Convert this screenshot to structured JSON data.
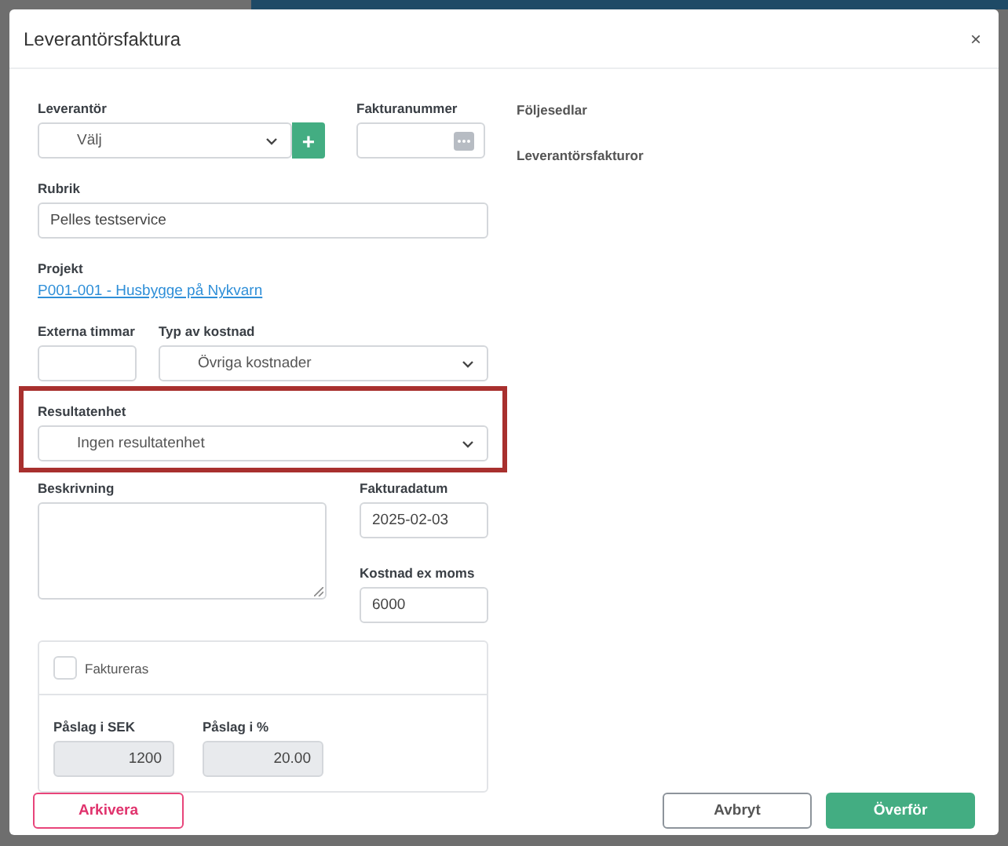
{
  "dialog": {
    "title": "Leverantörsfaktura",
    "close": "×"
  },
  "supplier": {
    "label": "Leverantör",
    "value": "Välj",
    "add": "+"
  },
  "invoice_number": {
    "label": "Fakturanummer"
  },
  "right_links": [
    "Följesedlar",
    "Leverantörsfakturor"
  ],
  "heading": {
    "label": "Rubrik",
    "value": "Pelles testservice"
  },
  "project": {
    "label": "Projekt",
    "link": "P001-001 - Husbygge på Nykvarn"
  },
  "external_hours": {
    "label": "Externa timmar"
  },
  "cost_type": {
    "label": "Typ av kostnad",
    "value": "Övriga kostnader"
  },
  "result_unit": {
    "label": "Resultatenhet",
    "value": "Ingen resultatenhet",
    "highlighted": true
  },
  "description": {
    "label": "Beskrivning"
  },
  "invoice_date": {
    "label": "Fakturadatum",
    "value": "2025-02-03"
  },
  "cost_ex_vat": {
    "label": "Kostnad ex moms",
    "value": "6000"
  },
  "invoiced": {
    "label": "Faktureras",
    "checked": false
  },
  "markup_sek": {
    "label": "Påslag i SEK",
    "value": "1200",
    "disabled": true
  },
  "markup_pct": {
    "label": "Påslag i %",
    "value": "20.00",
    "disabled": true
  },
  "buttons": {
    "archive": "Arkivera",
    "cancel": "Avbryt",
    "transfer": "Överför"
  }
}
